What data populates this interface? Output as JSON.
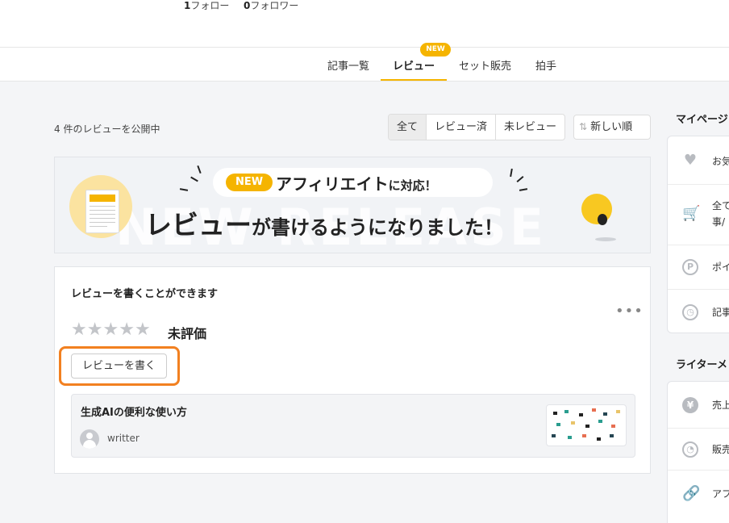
{
  "profile": {
    "following_count": "1",
    "following_label": "フォロー",
    "followers_count": "0",
    "followers_label": "フォロワー"
  },
  "tabs": [
    {
      "label": "記事一覧"
    },
    {
      "label": "レビュー",
      "active": true,
      "badge": "NEW"
    },
    {
      "label": "セット販売"
    },
    {
      "label": "拍手"
    }
  ],
  "reviews": {
    "count_text": "4 件のレビューを公開中",
    "filters": [
      "全て",
      "レビュー済",
      "未レビュー"
    ],
    "selected_filter": "全て",
    "sort_label": "新しい順"
  },
  "banner": {
    "badge": "NEW",
    "line1_main": "アフィリエイト",
    "line1_small": "に対応！",
    "line2_main": "レビュー",
    "line2_mid": "が書けるようになりました！",
    "background_text": "NEW RELEASE"
  },
  "review_card": {
    "title": "レビューを書くことができます",
    "rating": 0,
    "rating_max": 5,
    "unrated_label": "未評価",
    "write_button": "レビューを書く",
    "article_title": "生成AIの便利な使い方",
    "author": "writter"
  },
  "sidebar": {
    "mypage_title": "マイページ",
    "mypage_items": [
      {
        "icon": "heart-icon",
        "label": "お気"
      },
      {
        "icon": "cart-icon",
        "label": "全て",
        "label2": "事/"
      },
      {
        "icon": "point-icon",
        "label": "ポイ"
      },
      {
        "icon": "clock-icon",
        "label": "記事"
      }
    ],
    "writer_title": "ライターメ",
    "writer_items": [
      {
        "icon": "yen-icon",
        "label": "売上"
      },
      {
        "icon": "sales-icon",
        "label": "販売"
      },
      {
        "icon": "link-icon",
        "label": "アフ"
      }
    ]
  },
  "colors": {
    "accent": "#f5b400",
    "highlight": "#f28020",
    "star_empty": "#c3c5c9"
  }
}
